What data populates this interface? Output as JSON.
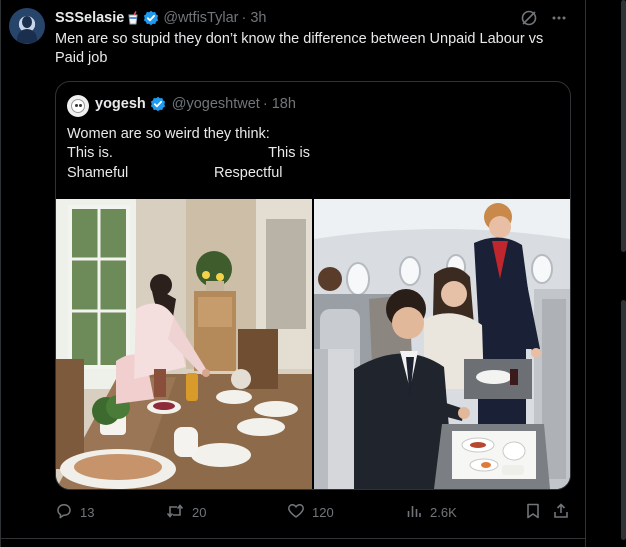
{
  "tweet": {
    "display_name": "SSSelasie",
    "handle": "@wtfisTylar",
    "time": "· 3h",
    "text": "Men are so stupid they don’t know the difference between Unpaid Labour vs Paid job",
    "author_emoji": "cup-with-straw-icon"
  },
  "quote": {
    "display_name": "yogesh",
    "handle": "@yogeshtwet",
    "time": "· 18h",
    "line1": "Women are so weird they think:",
    "left_line1": "This is.",
    "left_line2": "Shameful",
    "right_line1": "This is",
    "right_line2": "Respectful"
  },
  "actions": {
    "replies": "13",
    "retweets": "20",
    "likes": "120",
    "views": "2.6K"
  },
  "colors": {
    "background": "#000000",
    "text": "#e7e9ea",
    "muted": "#71767b",
    "verified": "#1d9bf0",
    "border": "#2f3336"
  }
}
